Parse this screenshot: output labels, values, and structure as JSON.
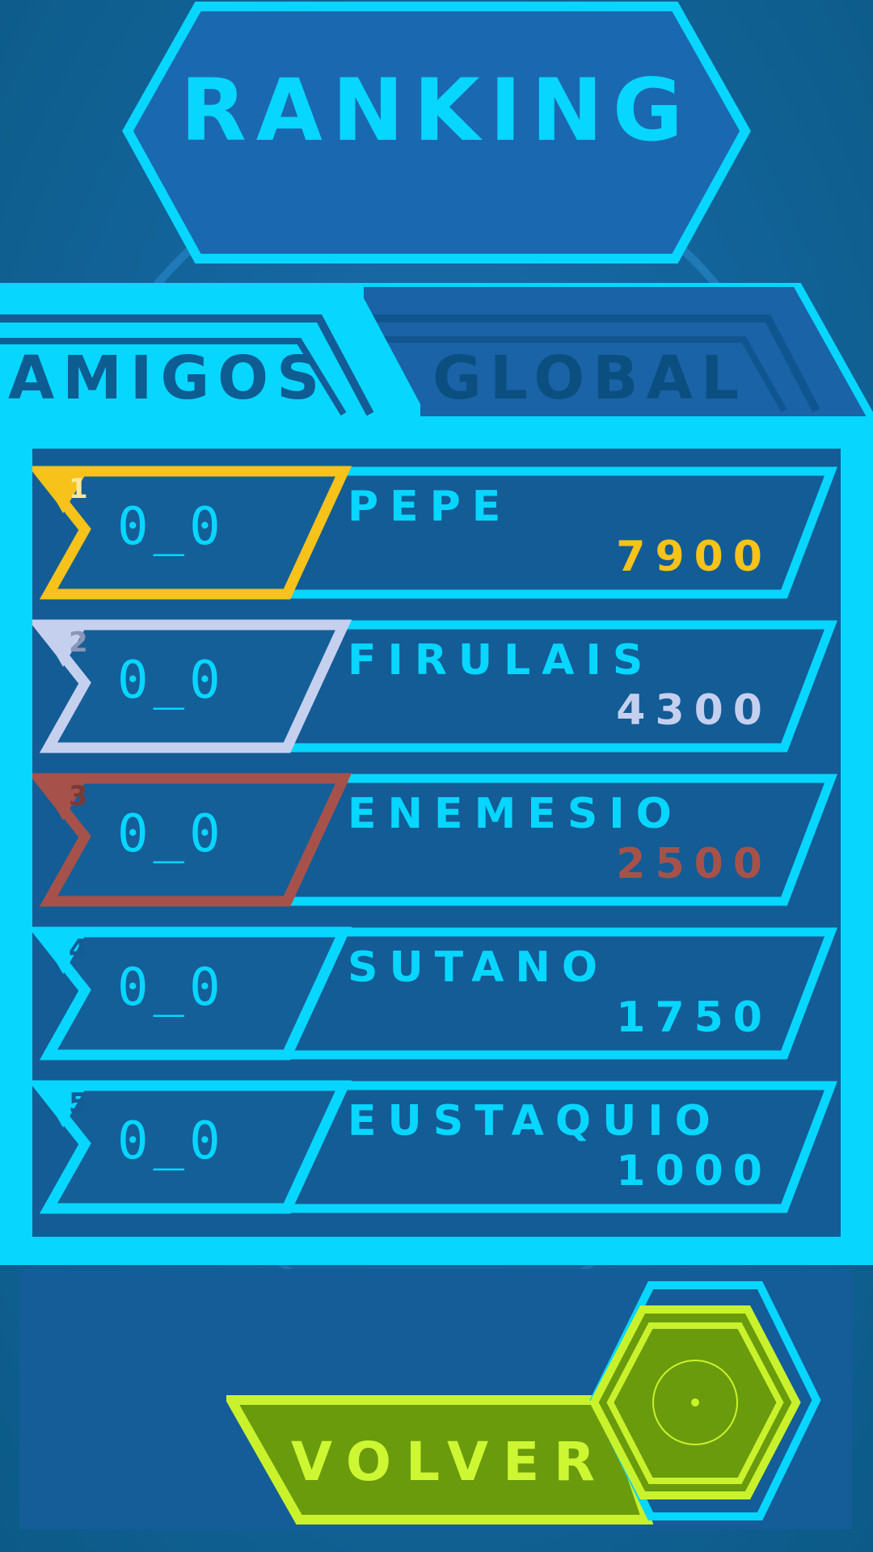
{
  "title": "RANKING",
  "tabs": [
    {
      "label": "AMIGOS",
      "active": true
    },
    {
      "label": "GLOBAL",
      "active": false
    }
  ],
  "rows": [
    {
      "rank": "1",
      "avatar": "0_0",
      "name": "PEPE",
      "score": "7900",
      "medal_color": "#f7c21a"
    },
    {
      "rank": "2",
      "avatar": "0_0",
      "name": "FIRULAIS",
      "score": "4300",
      "medal_color": "#c5d0ef"
    },
    {
      "rank": "3",
      "avatar": "0_0",
      "name": "ENEMESIO",
      "score": "2500",
      "medal_color": "#a6524a"
    },
    {
      "rank": "4",
      "avatar": "0_0",
      "name": "SUTANO",
      "score": "1750",
      "medal_color": ""
    },
    {
      "rank": "5",
      "avatar": "0_0",
      "name": "EUSTAQUIO",
      "score": "1000",
      "medal_color": ""
    }
  ],
  "back_button": {
    "label": "VOLVER"
  },
  "colors": {
    "accent": "#07d6ff",
    "panel": "#135c96",
    "background": "#0b5a86",
    "button_green": "#6a9b0c",
    "button_lime": "#c9f22c"
  },
  "icons": {
    "back": "hexagon-target-icon"
  }
}
